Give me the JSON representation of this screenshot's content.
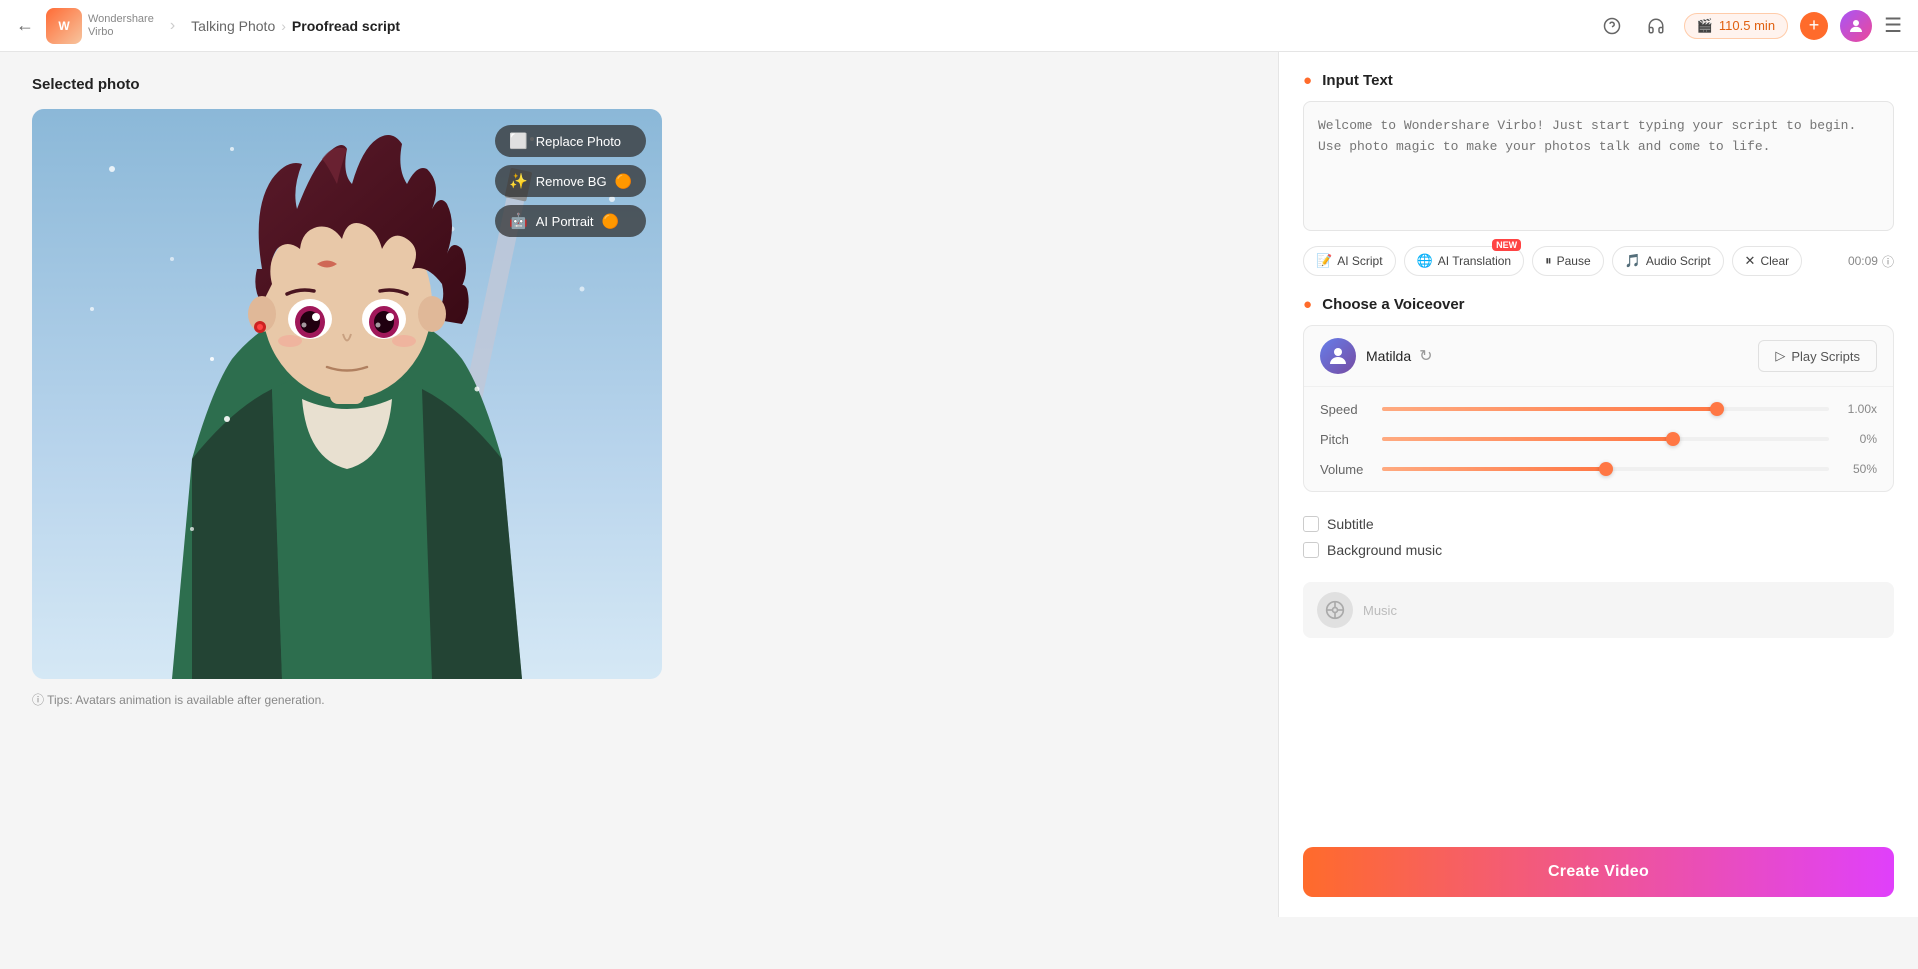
{
  "topbar": {
    "back_label": "←",
    "logo_text": "W",
    "brand_name": "Wondershare",
    "brand_sub": "Virbo",
    "nav_parent": "Talking Photo",
    "nav_sep": "›",
    "nav_current": "Proofread script",
    "help_icon": "?",
    "headset_icon": "🎧",
    "credit_amount": "110.5 min",
    "add_icon": "+",
    "menu_icon": "☰"
  },
  "left": {
    "section_title": "Selected photo",
    "photo_buttons": [
      {
        "id": "replace-photo",
        "icon": "⬜",
        "label": "Replace Photo"
      },
      {
        "id": "remove-bg",
        "icon": "✨",
        "label": "Remove BG"
      },
      {
        "id": "ai-portrait",
        "icon": "🤖",
        "label": "AI Portrait"
      }
    ],
    "tip_text": "ⓘ  Tips: Avatars animation is available after generation."
  },
  "right": {
    "input_section": {
      "title": "Input Text",
      "placeholder": "Welcome to Wondershare Virbo! Just start typing your script to begin. Use photo magic to make your photos talk and come to life.",
      "toolbar": [
        {
          "id": "ai-script",
          "icon": "📝",
          "label": "AI Script",
          "new_badge": false
        },
        {
          "id": "ai-translation",
          "icon": "🌐",
          "label": "AI Translation",
          "new_badge": true
        },
        {
          "id": "pause",
          "icon": "⏸",
          "label": "Pause",
          "new_badge": false
        },
        {
          "id": "audio-script",
          "icon": "🎵",
          "label": "Audio Script",
          "new_badge": false
        },
        {
          "id": "clear",
          "icon": "✕",
          "label": "Clear",
          "new_badge": false
        }
      ],
      "time": "00:09",
      "time_info_icon": "ⓘ"
    },
    "voiceover_section": {
      "title": "Choose a Voiceover",
      "voice_name": "Matilda",
      "refresh_icon": "↻",
      "play_scripts_icon": "▷",
      "play_scripts_label": "Play Scripts",
      "sliders": [
        {
          "id": "speed",
          "label": "Speed",
          "value": 1.0,
          "display": "1.00x",
          "percent": 75
        },
        {
          "id": "pitch",
          "label": "Pitch",
          "value": 0,
          "display": "0%",
          "percent": 65
        },
        {
          "id": "volume",
          "label": "Volume",
          "value": 50,
          "display": "50%",
          "percent": 50
        }
      ]
    },
    "subtitle": {
      "label": "Subtitle",
      "checked": false
    },
    "bg_music": {
      "label": "Background music",
      "checked": false
    },
    "music_placeholder": "Music",
    "create_btn_label": "Create Video"
  }
}
